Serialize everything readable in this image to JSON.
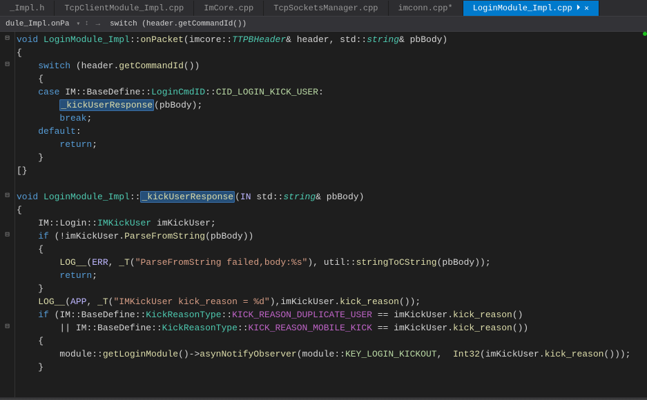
{
  "tabs": [
    {
      "label": "_Impl.h"
    },
    {
      "label": "TcpClientModule_Impl.cpp"
    },
    {
      "label": "ImCore.cpp"
    },
    {
      "label": "TcpSocketsManager.cpp"
    },
    {
      "label": "imconn.cpp*"
    },
    {
      "label": "LoginModule_Impl.cpp",
      "active": true
    }
  ],
  "nav": {
    "crumb1": "dule_Impl.onPa",
    "crumb2": "switch (header.getCommandId())"
  },
  "icons": {
    "close": "✕",
    "pin": "⏵",
    "dd": "▾",
    "arrows": "↕",
    "sep": "→",
    "boxminus": "⊟"
  },
  "code": {
    "sig1": {
      "kw": "void",
      "cls": "LoginModule_Impl",
      "fn": "onPacket",
      "ns": "imcore",
      "t1": "TTPBHeader",
      "p1": "header",
      "ns2": "std",
      "t2": "string",
      "p2": "pbBody"
    },
    "switch": {
      "kw": "switch",
      "obj": "header",
      "m": "getCommandId"
    },
    "case": {
      "kw": "case",
      "ns1": "IM",
      "ns2": "BaseDefine",
      "ns3": "LoginCmdID",
      "v": "CID_LOGIN_KICK_USER"
    },
    "call1": {
      "fn": "_kickUserResponse",
      "arg": "pbBody"
    },
    "break": "break",
    "default": "default",
    "return": "return",
    "sig2": {
      "kw": "void",
      "cls": "LoginModule_Impl",
      "fn": "_kickUserResponse",
      "mac": "IN",
      "ns": "std",
      "t": "string",
      "p": "pbBody"
    },
    "decl": {
      "ns1": "IM",
      "ns2": "Login",
      "t": "IMKickUser",
      "v": "imKickUser"
    },
    "if1": {
      "kw": "if",
      "obj": "imKickUser",
      "m": "ParseFromString",
      "arg": "pbBody"
    },
    "log1": {
      "fn": "LOG__",
      "l": "ERR",
      "mac": "_T",
      "s": "\"ParseFromString failed,body:%s\"",
      "ns": "util",
      "m": "stringToCString",
      "arg": "pbBody"
    },
    "log2": {
      "fn": "LOG__",
      "l": "APP",
      "mac": "_T",
      "s": "\"IMKickUser kick_reason = %d\"",
      "obj": "imKickUser",
      "m": "kick_reason"
    },
    "if2": {
      "kw": "if",
      "ns1": "IM",
      "ns2": "BaseDefine",
      "ns3": "KickReasonType",
      "e1": "KICK_REASON_DUPLICATE_USER",
      "e2": "KICK_REASON_MOBILE_KICK",
      "obj": "imKickUser",
      "m": "kick_reason"
    },
    "body": {
      "ns": "module",
      "f1": "getLoginModule",
      "f2": "asynNotifyObserver",
      "ns2": "module",
      "k": "KEY_LOGIN_KICKOUT",
      "t": "Int32",
      "obj": "imKickUser",
      "m": "kick_reason"
    }
  }
}
